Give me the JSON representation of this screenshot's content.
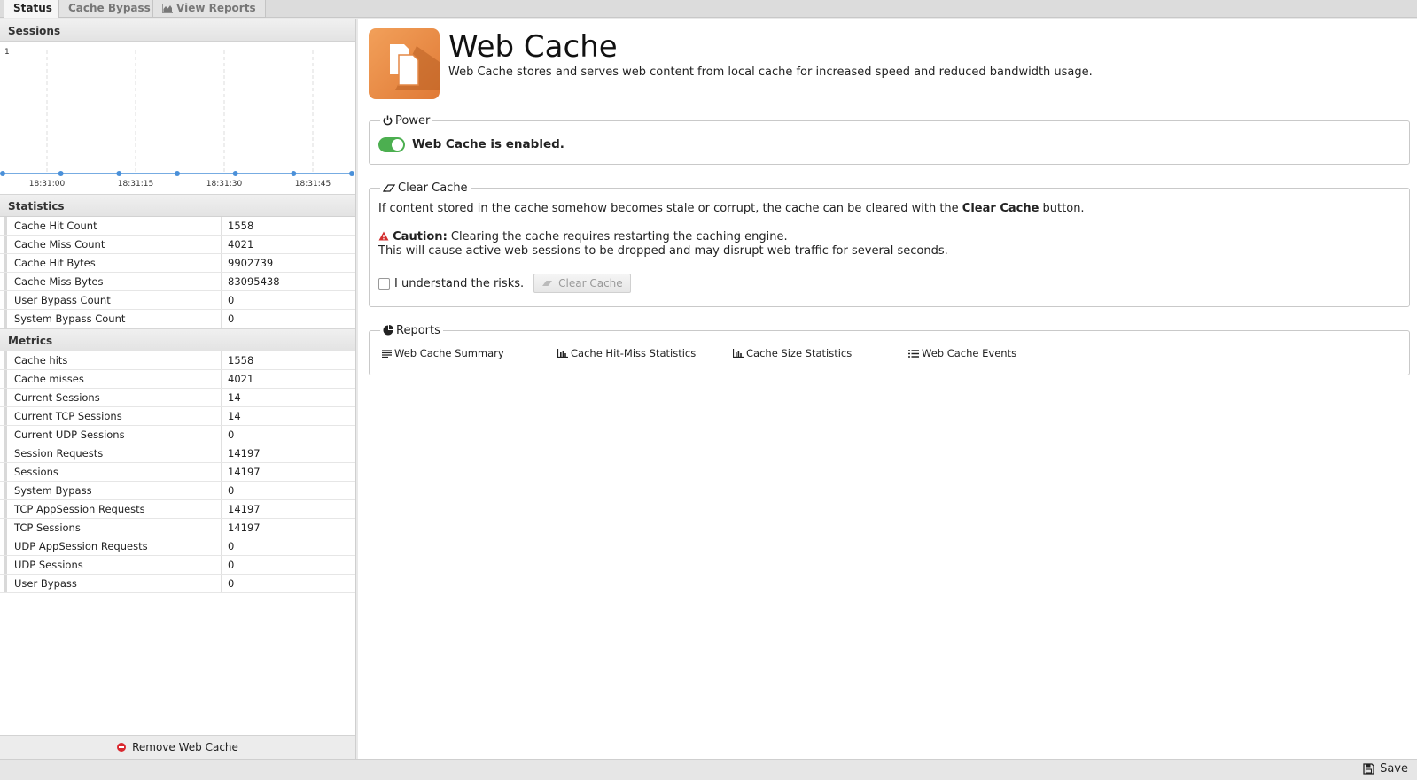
{
  "tabs": [
    {
      "label": "Status",
      "active": true
    },
    {
      "label": "Cache Bypass",
      "active": false
    },
    {
      "label": "View Reports",
      "active": false,
      "icon": "chart-area-icon"
    }
  ],
  "left": {
    "sessions_title": "Sessions",
    "chart_data": {
      "type": "line",
      "title": "",
      "ylabel": "",
      "xlabel": "",
      "x_ticks": [
        "18:31:00",
        "18:31:15",
        "18:31:30",
        "18:31:45"
      ],
      "y_ticks": [
        "1"
      ],
      "ylim": [
        0,
        1
      ],
      "series": [
        {
          "values": [
            0,
            0,
            0,
            0,
            0,
            0,
            0
          ]
        }
      ],
      "grid": "vertical-dashed",
      "color": "#4a90d9"
    },
    "statistics_title": "Statistics",
    "statistics": [
      {
        "label": "Cache Hit Count",
        "value": "1558"
      },
      {
        "label": "Cache Miss Count",
        "value": "4021"
      },
      {
        "label": "Cache Hit Bytes",
        "value": "9902739"
      },
      {
        "label": "Cache Miss Bytes",
        "value": "83095438"
      },
      {
        "label": "User Bypass Count",
        "value": "0"
      },
      {
        "label": "System Bypass Count",
        "value": "0"
      }
    ],
    "metrics_title": "Metrics",
    "metrics": [
      {
        "label": "Cache hits",
        "value": "1558"
      },
      {
        "label": "Cache misses",
        "value": "4021"
      },
      {
        "label": "Current Sessions",
        "value": "14"
      },
      {
        "label": "Current TCP Sessions",
        "value": "14"
      },
      {
        "label": "Current UDP Sessions",
        "value": "0"
      },
      {
        "label": "Session Requests",
        "value": "14197"
      },
      {
        "label": "Sessions",
        "value": "14197"
      },
      {
        "label": "System Bypass",
        "value": "0"
      },
      {
        "label": "TCP AppSession Requests",
        "value": "14197"
      },
      {
        "label": "TCP Sessions",
        "value": "14197"
      },
      {
        "label": "UDP AppSession Requests",
        "value": "0"
      },
      {
        "label": "UDP Sessions",
        "value": "0"
      },
      {
        "label": "User Bypass",
        "value": "0"
      }
    ],
    "remove_label": "Remove Web Cache"
  },
  "app": {
    "title": "Web Cache",
    "description": "Web Cache stores and serves web content from local cache for increased speed and reduced bandwidth usage."
  },
  "power": {
    "legend": "Power",
    "status": "Web Cache is enabled.",
    "enabled": true,
    "toggle_color": "#4caf50"
  },
  "clear_cache": {
    "legend": "Clear Cache",
    "line1_pre": "If content stored in the cache somehow becomes stale or corrupt, the cache can be cleared with the ",
    "line1_bold": "Clear Cache",
    "line1_post": " button.",
    "caution_label": "Caution:",
    "caution_text": " Clearing the cache requires restarting the caching engine.",
    "caution_line2": "This will cause active web sessions to be dropped and may disrupt web traffic for several seconds.",
    "checkbox_label": "I understand the risks.",
    "checked": false,
    "button_label": "Clear Cache"
  },
  "reports": {
    "legend": "Reports",
    "links": [
      {
        "label": "Web Cache Summary",
        "icon": "text-align-icon"
      },
      {
        "label": "Cache Hit-Miss Statistics",
        "icon": "bar-chart-icon"
      },
      {
        "label": "Cache Size Statistics",
        "icon": "bar-chart-icon"
      },
      {
        "label": "Web Cache Events",
        "icon": "list-icon"
      }
    ]
  },
  "footer": {
    "save_label": "Save"
  }
}
